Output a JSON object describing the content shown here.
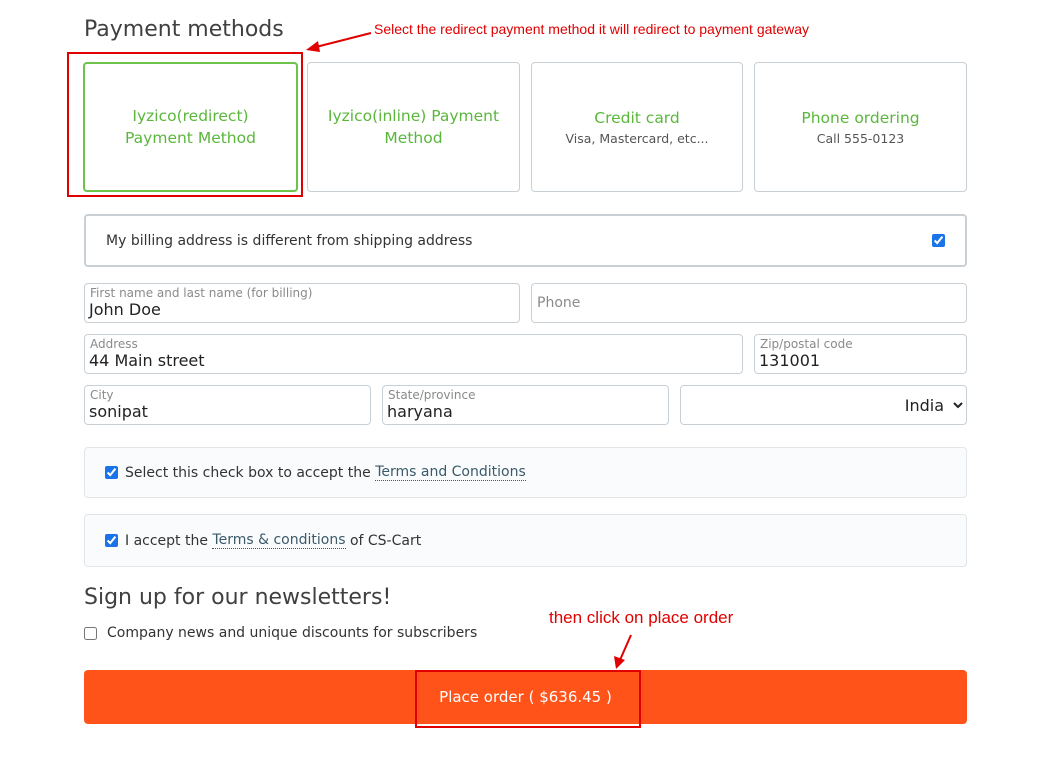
{
  "payment": {
    "title": "Payment methods",
    "methods": [
      {
        "name": "Iyzico(redirect) Payment Method",
        "desc": "",
        "selected": true
      },
      {
        "name": "Iyzico(inline) Payment Method",
        "desc": "",
        "selected": false
      },
      {
        "name": "Credit card",
        "desc": "Visa, Mastercard, etc...",
        "selected": false
      },
      {
        "name": "Phone ordering",
        "desc": "Call 555-0123",
        "selected": false
      }
    ]
  },
  "billing": {
    "different_label": "My billing address is different from shipping address",
    "different_checked": true,
    "fields": {
      "name": {
        "label": "First name and last name (for billing)",
        "value": "John Doe"
      },
      "phone": {
        "placeholder": "Phone",
        "value": ""
      },
      "address": {
        "label": "Address",
        "value": "44 Main street"
      },
      "zip": {
        "label": "Zip/postal code",
        "value": "131001"
      },
      "city": {
        "label": "City",
        "value": "sonipat"
      },
      "state": {
        "label": "State/province",
        "value": "haryana"
      },
      "country": {
        "value": "India"
      }
    }
  },
  "terms": {
    "accept_prefix": "Select this check box to accept the ",
    "accept_link": "Terms and Conditions",
    "cscart_prefix": "I accept the ",
    "cscart_link": "Terms & conditions",
    "cscart_suffix": " of CS-Cart"
  },
  "newsletter": {
    "title": "Sign up for our newsletters!",
    "option": "Company news and unique discounts for subscribers"
  },
  "place_order": {
    "label": "Place order ( $636.45 )"
  },
  "annotations": {
    "redirect_note": "Select the redirect payment method  it will redirect to payment gateway",
    "place_note": "then click on place order",
    "color": "#e00000"
  },
  "colors": {
    "accent_green": "#5ab73c",
    "button_orange": "#ff5319",
    "checkbox_blue": "#1a73e8"
  }
}
